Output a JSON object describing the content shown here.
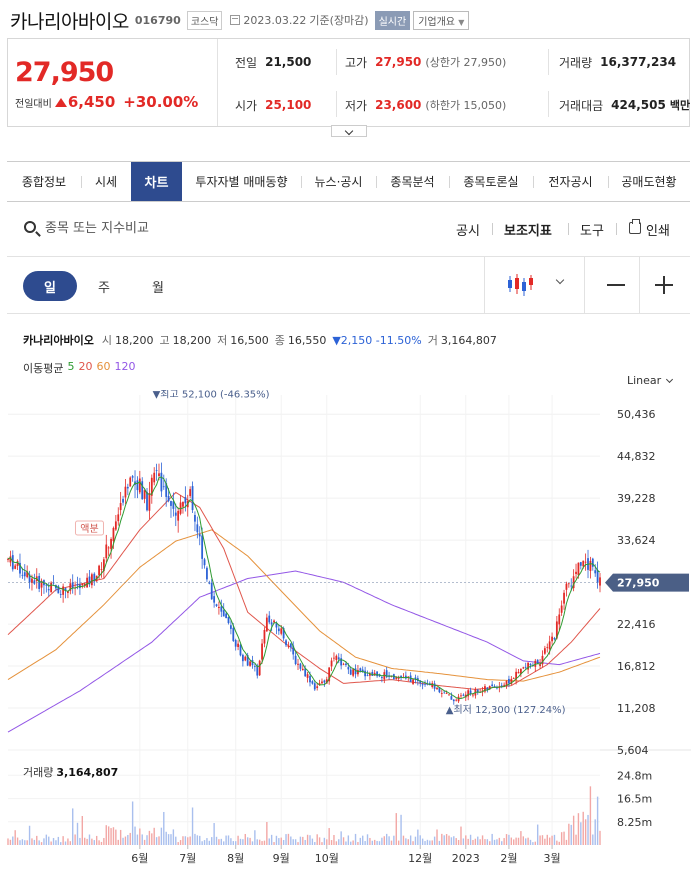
{
  "header": {
    "stock_name": "카나리아바이오",
    "stock_code": "016790",
    "market_badge": "코스닥",
    "date": "2023.03.22",
    "date_basis": "기준(장마감)",
    "live_badge": "실시간",
    "info_badge": "기업개요"
  },
  "price": {
    "current": "27,950",
    "change_label": "전일대비",
    "change_value": "6,450",
    "change_pct": "+30.00%"
  },
  "quotes": {
    "prev_label": "전일",
    "prev_value": "21,500",
    "high_label": "고가",
    "high_value": "27,950",
    "upper_limit": "(상한가 27,950)",
    "volume_label": "거래량",
    "volume_value": "16,377,234",
    "open_label": "시가",
    "open_value": "25,100",
    "low_label": "저가",
    "low_value": "23,600",
    "lower_limit": "(하한가 15,050)",
    "amount_label": "거래대금",
    "amount_value": "424,505",
    "amount_unit": "백만"
  },
  "tabs": [
    "종합정보",
    "시세",
    "차트",
    "투자자별 매매동향",
    "뉴스·공시",
    "종목분석",
    "종목토론실",
    "전자공시",
    "공매도현황"
  ],
  "active_tab": "차트",
  "search": {
    "placeholder": "종목 또는 지수비교"
  },
  "tools": {
    "notice": "공시",
    "indicator": "보조지표",
    "tools": "도구",
    "print": "인쇄"
  },
  "periods": {
    "day": "일",
    "week": "주",
    "month": "월",
    "active": "일"
  },
  "legend": {
    "name": "카나리아바이오",
    "open_label": "시",
    "open": "18,200",
    "high_label": "고",
    "high": "18,200",
    "low_label": "저",
    "low": "16,500",
    "close_label": "종",
    "close": "16,550",
    "change": "▼2,150 -11.50%",
    "volume_label": "거",
    "volume": "3,164,807",
    "ma_label": "이동평균",
    "ma": [
      {
        "period": "5",
        "color": "#2f9b32"
      },
      {
        "period": "20",
        "color": "#e0564c"
      },
      {
        "period": "60",
        "color": "#e5923c"
      },
      {
        "period": "120",
        "color": "#9357e6"
      }
    ]
  },
  "scale": {
    "type": "Linear"
  },
  "volume_panel": {
    "label": "거래량",
    "value": "3,164,807"
  },
  "chart_data": {
    "type": "candlestick",
    "price_ticks": [
      "50,436",
      "44,832",
      "39,228",
      "33,624",
      "22,416",
      "16,812",
      "11,208",
      "5,604"
    ],
    "price_tick_values": [
      50436,
      44832,
      39228,
      33624,
      22416,
      16812,
      11208,
      5604
    ],
    "current_price_label": "27,950",
    "current_price_value": 27950,
    "ylim": [
      5604,
      53000
    ],
    "volume_ticks": [
      "24.8m",
      "16.5m",
      "8.25m"
    ],
    "volume_tick_values": [
      24.8,
      16.5,
      8.25
    ],
    "volume_ylim": [
      0,
      32
    ],
    "month_labels": [
      "6월",
      "7월",
      "8월",
      "9월",
      "10월",
      "12월",
      "2023",
      "2월",
      "3월"
    ],
    "month_positions": [
      55,
      75,
      95,
      114,
      133,
      172,
      191,
      209,
      227
    ],
    "x_range": [
      0,
      247
    ],
    "max_annotation": {
      "text": "▼최고 52,100 (-46.35%)",
      "value": 52100,
      "x": 62
    },
    "min_annotation": {
      "text": "▲최저 12,300 (127.24%)",
      "value": 12300,
      "x": 186
    },
    "event_label": "액분",
    "event_x": 34,
    "close_anchors": [
      [
        0,
        31000
      ],
      [
        12,
        28000
      ],
      [
        22,
        27000
      ],
      [
        32,
        27500
      ],
      [
        38,
        29500
      ],
      [
        45,
        36000
      ],
      [
        52,
        43000
      ],
      [
        58,
        38500
      ],
      [
        62,
        44000
      ],
      [
        65,
        40000
      ],
      [
        70,
        38000
      ],
      [
        76,
        39500
      ],
      [
        80,
        33500
      ],
      [
        85,
        26000
      ],
      [
        92,
        22000
      ],
      [
        98,
        18000
      ],
      [
        104,
        16000
      ],
      [
        108,
        23000
      ],
      [
        114,
        21500
      ],
      [
        120,
        17500
      ],
      [
        125,
        15500
      ],
      [
        128,
        14000
      ],
      [
        132,
        14500
      ],
      [
        136,
        18000
      ],
      [
        143,
        16000
      ],
      [
        160,
        15500
      ],
      [
        175,
        14500
      ],
      [
        182,
        13200
      ],
      [
        186,
        12300
      ],
      [
        192,
        13200
      ],
      [
        200,
        13800
      ],
      [
        208,
        14500
      ],
      [
        215,
        16500
      ],
      [
        222,
        17500
      ],
      [
        228,
        21000
      ],
      [
        232,
        26500
      ],
      [
        238,
        30000
      ],
      [
        244,
        30500
      ],
      [
        247,
        27950
      ]
    ],
    "ma20_anchors": [
      [
        0,
        21000
      ],
      [
        20,
        27000
      ],
      [
        40,
        28500
      ],
      [
        55,
        35000
      ],
      [
        70,
        40000
      ],
      [
        80,
        38000
      ],
      [
        90,
        32500
      ],
      [
        100,
        24000
      ],
      [
        115,
        20000
      ],
      [
        130,
        16500
      ],
      [
        140,
        14500
      ],
      [
        160,
        15000
      ],
      [
        180,
        14200
      ],
      [
        195,
        13700
      ],
      [
        210,
        14200
      ],
      [
        225,
        17000
      ],
      [
        235,
        20000
      ],
      [
        247,
        24500
      ]
    ],
    "ma60_anchors": [
      [
        0,
        15000
      ],
      [
        20,
        19000
      ],
      [
        40,
        25000
      ],
      [
        55,
        30000
      ],
      [
        70,
        33500
      ],
      [
        85,
        35000
      ],
      [
        100,
        31500
      ],
      [
        115,
        26500
      ],
      [
        130,
        21500
      ],
      [
        145,
        18000
      ],
      [
        160,
        16500
      ],
      [
        180,
        15800
      ],
      [
        200,
        15000
      ],
      [
        215,
        14800
      ],
      [
        230,
        16000
      ],
      [
        247,
        18000
      ]
    ],
    "ma120_anchors": [
      [
        0,
        8000
      ],
      [
        30,
        13500
      ],
      [
        60,
        20000
      ],
      [
        80,
        26000
      ],
      [
        100,
        28500
      ],
      [
        120,
        29500
      ],
      [
        140,
        28000
      ],
      [
        160,
        25000
      ],
      [
        180,
        22500
      ],
      [
        200,
        20000
      ],
      [
        215,
        17500
      ],
      [
        230,
        17000
      ],
      [
        247,
        18500
      ]
    ]
  }
}
